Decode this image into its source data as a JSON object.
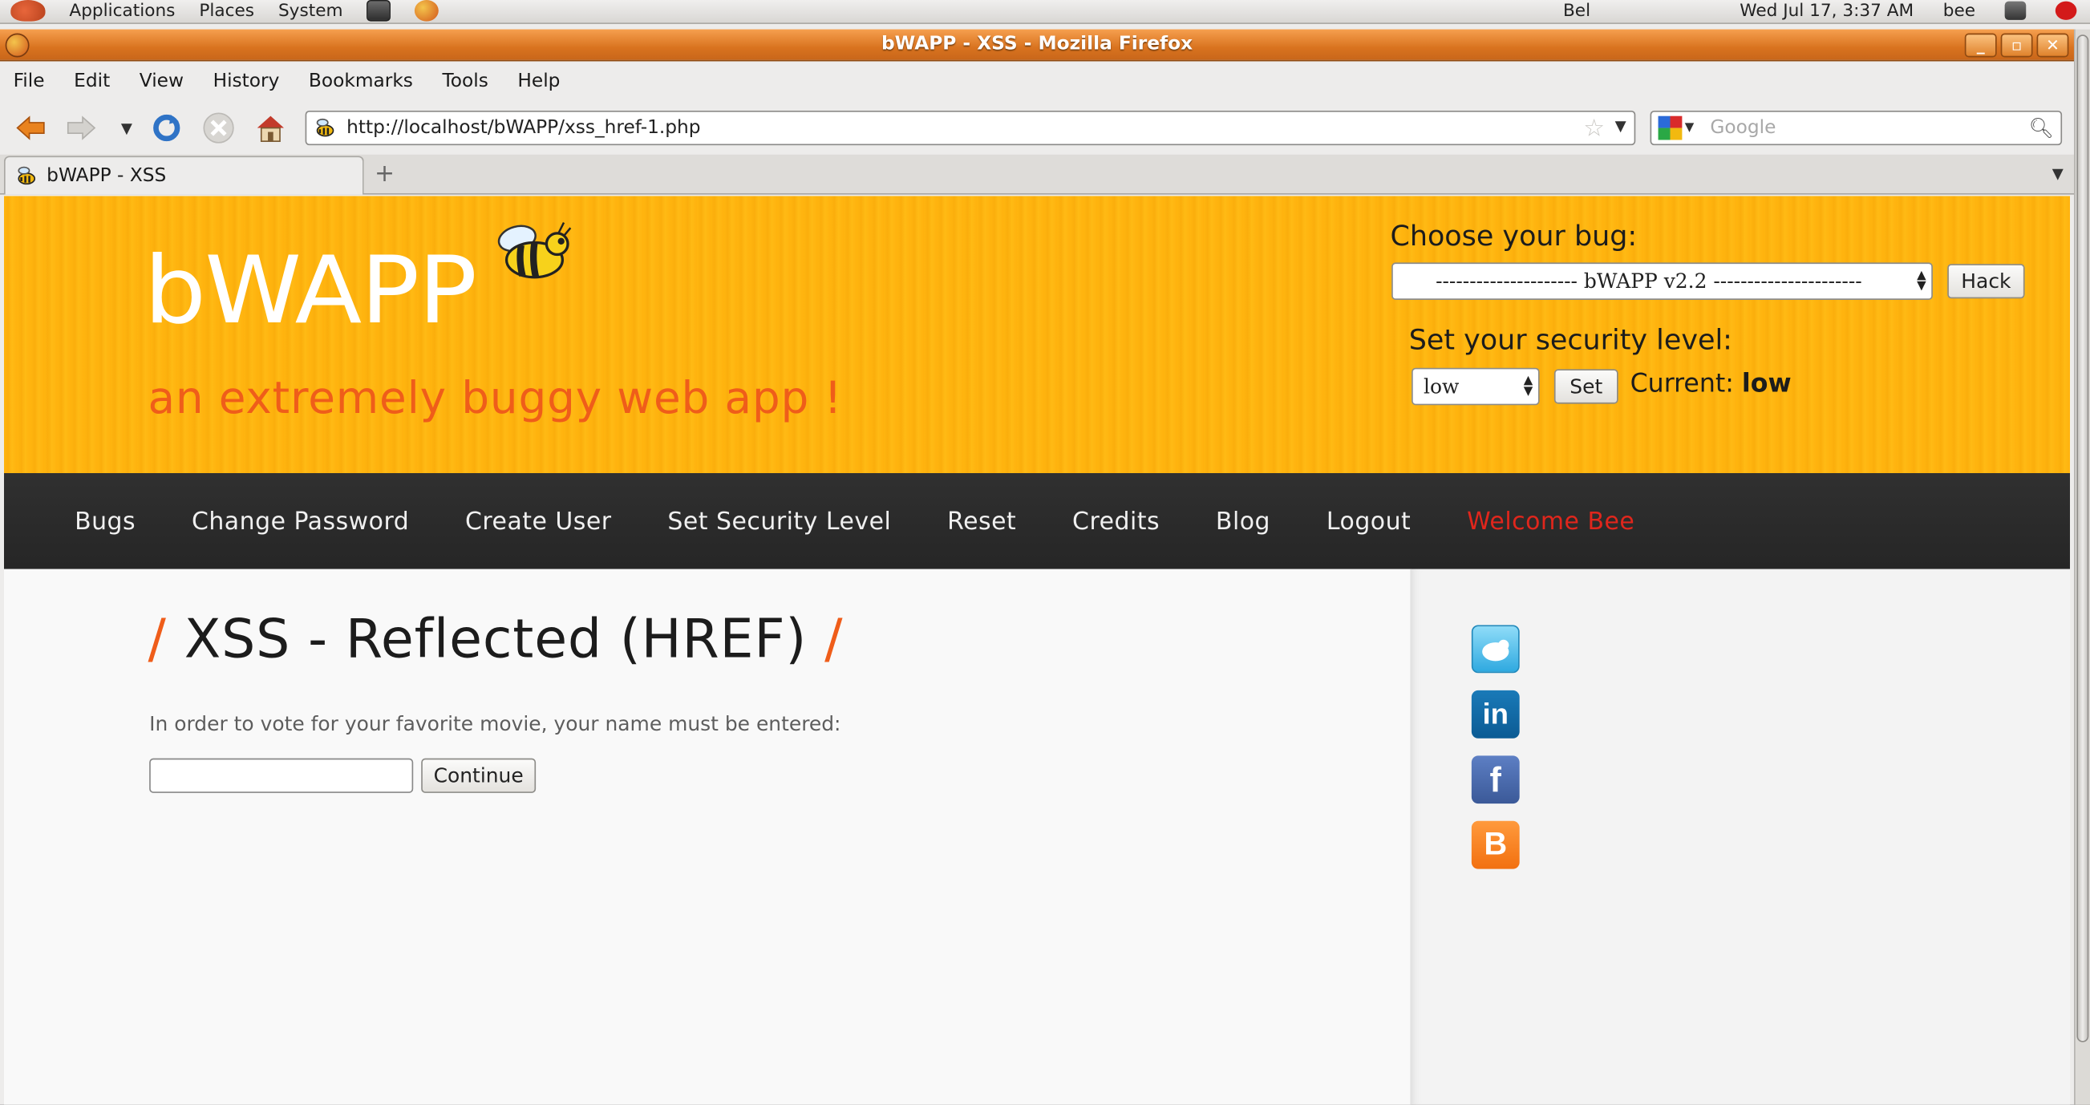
{
  "gnome_panel": {
    "menus": [
      "Applications",
      "Places",
      "System"
    ],
    "keyboard": "Bel",
    "clock": "Wed Jul 17,  3:37 AM",
    "user": "bee"
  },
  "window": {
    "title": "bWAPP - XSS - Mozilla Firefox"
  },
  "menubar": {
    "items": [
      "File",
      "Edit",
      "View",
      "History",
      "Bookmarks",
      "Tools",
      "Help"
    ]
  },
  "navbar": {
    "url": "http://localhost/bWAPP/xss_href-1.php",
    "search_placeholder": "Google"
  },
  "tabs": [
    {
      "label": "bWAPP - XSS"
    }
  ],
  "header": {
    "logo": "bWAPP",
    "tagline": "an extremely buggy web app !",
    "choose_bug_label": "Choose your bug:",
    "bug_select_value": "--------------------- bWAPP v2.2 ----------------------",
    "hack_button": "Hack",
    "security_label": "Set your security level:",
    "security_select_value": "low",
    "set_button": "Set",
    "current_label": "Current: ",
    "current_value": "low"
  },
  "mainnav": {
    "links": [
      "Bugs",
      "Change Password",
      "Create User",
      "Set Security Level",
      "Reset",
      "Credits",
      "Blog",
      "Logout"
    ],
    "welcome": "Welcome Bee"
  },
  "content": {
    "title": "XSS - Reflected (HREF)",
    "instructions": "In order to vote for your favorite movie, your name must be entered:",
    "name_value": "",
    "continue_button": "Continue"
  },
  "sidebar": {
    "icons": [
      "twitter-icon",
      "linkedin-icon",
      "facebook-icon",
      "blogger-icon"
    ]
  }
}
